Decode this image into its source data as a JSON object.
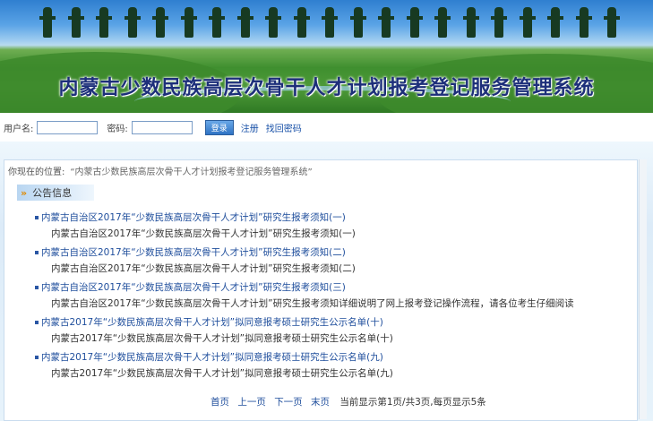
{
  "banner": {
    "title": "内蒙古少数民族高层次骨干人才计划报考登记服务管理系统"
  },
  "login": {
    "username_label": "用户名:",
    "username_value": "",
    "password_label": "密码:",
    "password_value": "",
    "login_button": "登录",
    "register_link": "注册",
    "recover_link": "找回密码"
  },
  "breadcrumb": {
    "label": "你现在的位置:",
    "location": "“内蒙古少数民族高层次骨干人才计划报考登记服务管理系统”"
  },
  "notices": {
    "heading": "公告信息",
    "items": [
      {
        "title": "内蒙古自治区2017年“少数民族高层次骨干人才计划”研究生报考须知(一)",
        "summary": "内蒙古自治区2017年“少数民族高层次骨干人才计划”研究生报考须知(一)"
      },
      {
        "title": "内蒙古自治区2017年“少数民族高层次骨干人才计划”研究生报考须知(二)",
        "summary": "内蒙古自治区2017年“少数民族高层次骨干人才计划”研究生报考须知(二)"
      },
      {
        "title": "内蒙古自治区2017年“少数民族高层次骨干人才计划”研究生报考须知(三)",
        "summary": "内蒙古自治区2017年“少数民族高层次骨干人才计划”研究生报考须知详细说明了网上报考登记操作流程，请各位考生仔细阅读"
      },
      {
        "title": "内蒙古2017年“少数民族高层次骨干人才计划”拟同意报考硕士研究生公示名单(十)",
        "summary": "内蒙古2017年“少数民族高层次骨干人才计划”拟同意报考硕士研究生公示名单(十)"
      },
      {
        "title": "内蒙古2017年“少数民族高层次骨干人才计划”拟同意报考硕士研究生公示名单(九)",
        "summary": "内蒙古2017年“少数民族高层次骨干人才计划”拟同意报考硕士研究生公示名单(九)"
      }
    ]
  },
  "pager": {
    "first": "首页",
    "prev": "上一页",
    "next": "下一页",
    "last": "末页",
    "info": "当前显示第1页/共3页,每页显示5条"
  },
  "colors": {
    "link": "#1f4e9c",
    "title": "#1d2f7a",
    "accent": "#e08a00"
  }
}
